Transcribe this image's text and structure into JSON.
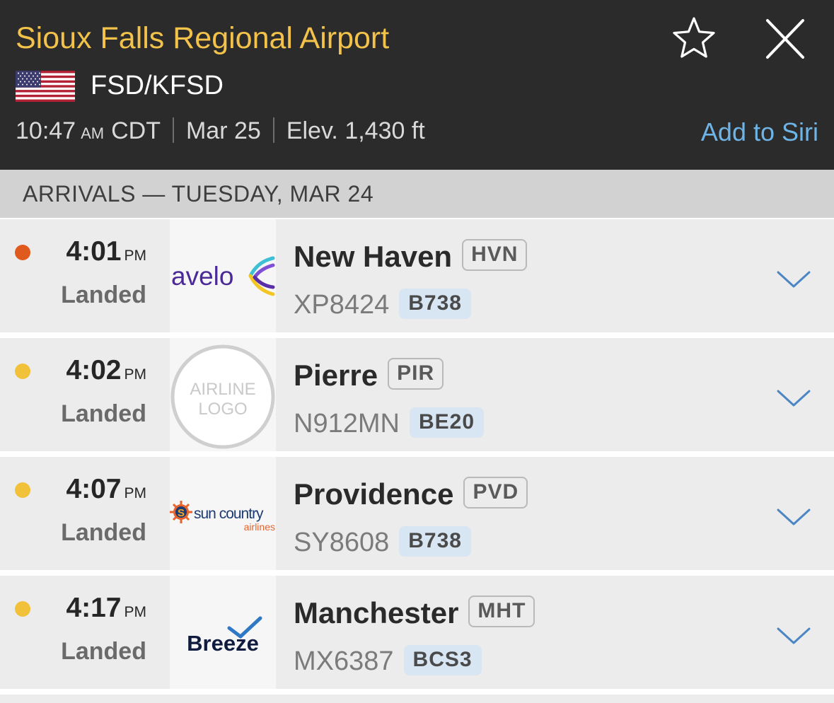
{
  "header": {
    "airport_name": "Sioux Falls Regional Airport",
    "codes": "FSD/KFSD",
    "time": "10:47",
    "ampm": "AM",
    "timezone": "CDT",
    "date": "Mar 25",
    "elevation": "Elev. 1,430 ft",
    "siri_label": "Add to Siri",
    "star_icon": "star-icon",
    "close_icon": "close-icon",
    "flag_icon": "us-flag-icon"
  },
  "section": {
    "title": "ARRIVALS — TUESDAY, MAR 24"
  },
  "colors": {
    "title": "#f2c24a",
    "siri": "#6fb4e6",
    "dot_orange": "#e05a1e",
    "dot_yellow": "#f2c13a",
    "chevron": "#4b86c4"
  },
  "arrivals": [
    {
      "time": "4:01",
      "ampm": "PM",
      "status": "Landed",
      "dot": "orange",
      "airline_logo": "avelo",
      "logo_text": "avelo",
      "city": "New Haven",
      "airport_code": "HVN",
      "flight": "XP8424",
      "aircraft": "B738"
    },
    {
      "time": "4:02",
      "ampm": "PM",
      "status": "Landed",
      "dot": "yellow",
      "airline_logo": "generic",
      "logo_text_1": "AIRLINE",
      "logo_text_2": "LOGO",
      "city": "Pierre",
      "airport_code": "PIR",
      "flight": "N912MN",
      "aircraft": "BE20"
    },
    {
      "time": "4:07",
      "ampm": "PM",
      "status": "Landed",
      "dot": "yellow",
      "airline_logo": "sun-country",
      "logo_text_1": "sun country",
      "logo_text_2": "airlines",
      "city": "Providence",
      "airport_code": "PVD",
      "flight": "SY8608",
      "aircraft": "B738"
    },
    {
      "time": "4:17",
      "ampm": "PM",
      "status": "Landed",
      "dot": "yellow",
      "airline_logo": "breeze",
      "logo_text": "Breeze",
      "city": "Manchester",
      "airport_code": "MHT",
      "flight": "MX6387",
      "aircraft": "BCS3"
    }
  ]
}
